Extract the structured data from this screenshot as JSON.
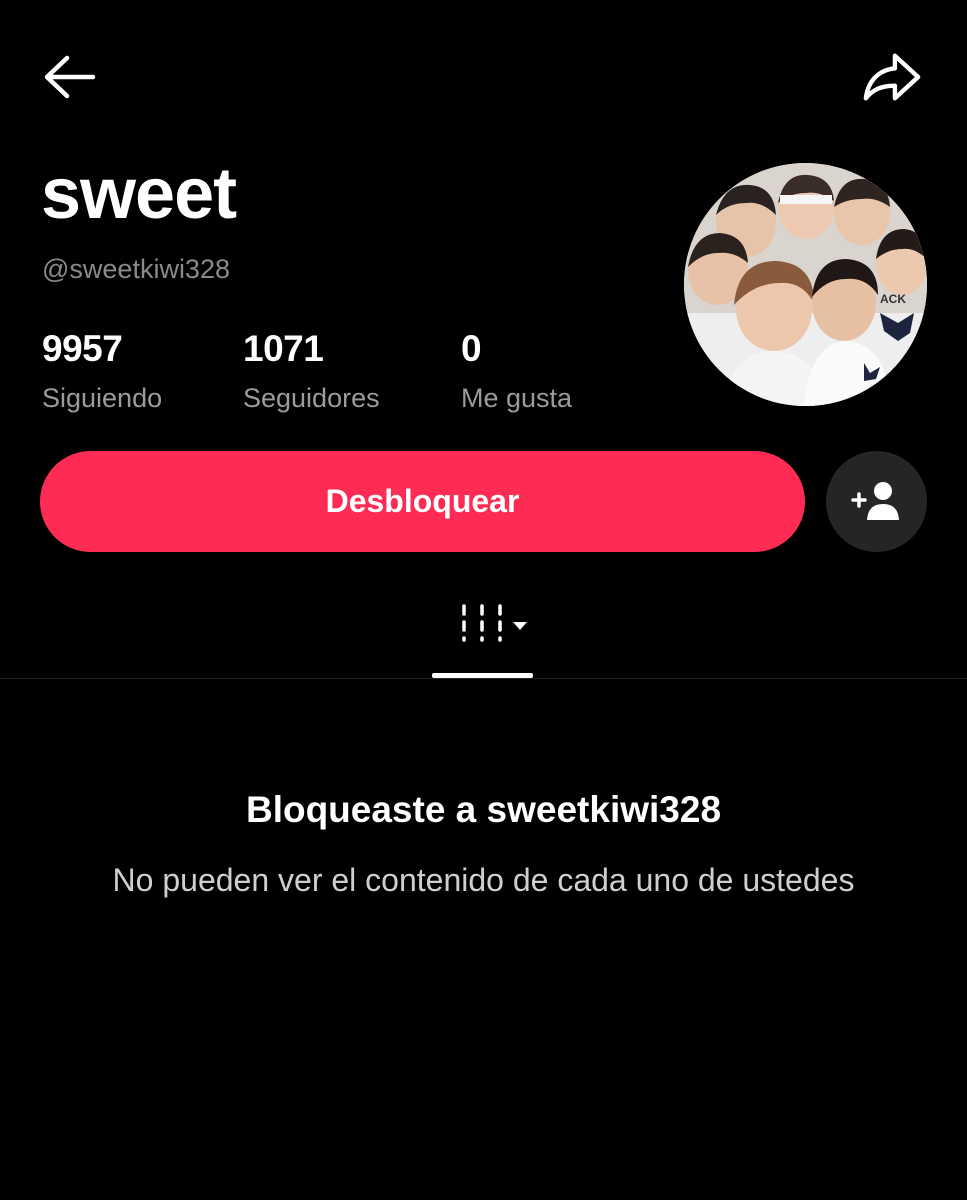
{
  "profile": {
    "display_name": "sweet",
    "username": "@sweetkiwi328",
    "stats": [
      {
        "value": "9957",
        "label": "Siguiendo"
      },
      {
        "value": "1071",
        "label": "Seguidores"
      },
      {
        "value": "0",
        "label": "Me gusta"
      }
    ],
    "avatar_icon": "group-photo-avatar"
  },
  "actions": {
    "unblock_label": "Desbloquear",
    "add_friend_icon": "add-user-icon"
  },
  "tabs": {
    "active_icon": "videos-grid-icon",
    "dropdown_icon": "caret-down-icon"
  },
  "blocked": {
    "title": "Bloqueaste a sweetkiwi328",
    "description": "No pueden ver el contenido de cada uno de ustedes"
  },
  "colors": {
    "accent": "#fe2c55",
    "background": "#000000",
    "secondary_text": "#8a8a8a"
  }
}
